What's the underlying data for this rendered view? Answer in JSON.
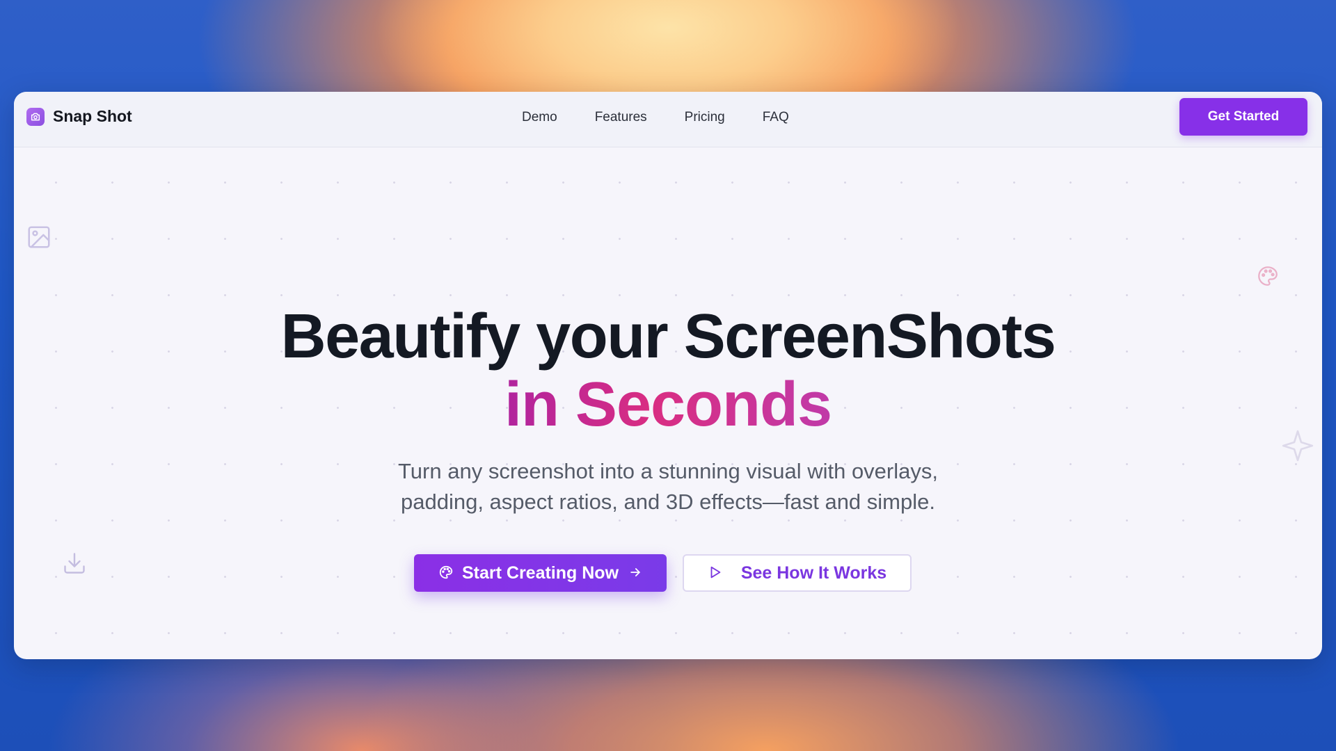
{
  "brand": {
    "name": "Snap Shot",
    "icon": "camera-icon"
  },
  "nav": {
    "links": [
      {
        "label": "Demo"
      },
      {
        "label": "Features"
      },
      {
        "label": "Pricing"
      },
      {
        "label": "FAQ"
      }
    ],
    "cta_label": "Get Started"
  },
  "hero": {
    "title_line1": "Beautify your ScreenShots",
    "title_line2": "in Seconds",
    "subtitle_line1": "Turn any screenshot into a stunning visual with overlays,",
    "subtitle_line2": "padding, aspect ratios, and 3D effects—fast and simple.",
    "primary_button": {
      "label": "Start Creating Now",
      "icon": "palette-icon",
      "trailing_icon": "arrow-right-icon"
    },
    "secondary_button": {
      "label": "See How It Works",
      "icon": "play-icon"
    }
  },
  "decorations": {
    "icons": [
      "image-icon",
      "palette-icon",
      "sparkle-icon",
      "download-icon"
    ]
  },
  "colors": {
    "accent": "#8730e8",
    "title_text": "#141923",
    "accent_gradient_start": "#b0249e",
    "accent_gradient_end": "#d92d82"
  }
}
